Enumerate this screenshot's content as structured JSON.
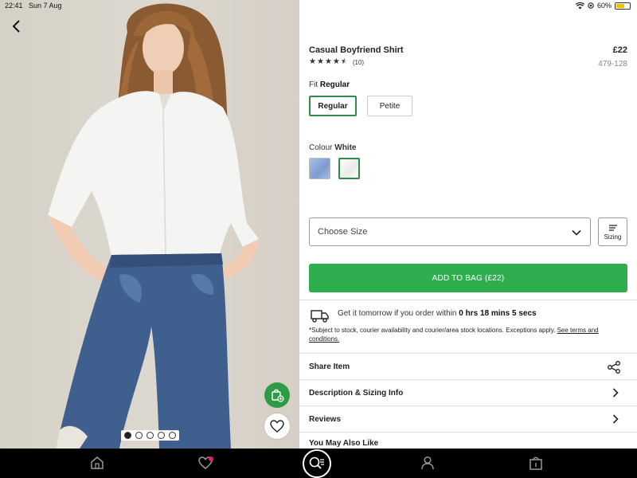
{
  "status_bar": {
    "time": "22:41",
    "date": "Sun 7 Aug",
    "battery": "60%",
    "battery_level": 0.6
  },
  "product": {
    "title": "Casual Boyfriend Shirt",
    "price": "£22",
    "code": "479-128",
    "rating": 4.5,
    "rating_count": "(10)",
    "image_count": 5,
    "active_image": 0
  },
  "fit": {
    "label": "Fit",
    "selected": "Regular",
    "options": [
      "Regular",
      "Petite"
    ]
  },
  "colour": {
    "label": "Colour",
    "selected": "White",
    "swatches": [
      "blue",
      "white"
    ]
  },
  "size_select": {
    "placeholder": "Choose Size"
  },
  "sizing_button": {
    "label": "Sizing"
  },
  "add_to_bag": {
    "label": "ADD TO BAG (£22)"
  },
  "delivery": {
    "prefix": "Get it tomorrow if you order within ",
    "countdown": "0 hrs 18 mins 5 secs",
    "disclaimer": "*Subject to stock, courier availability and courier/area stock locations. Exceptions apply. ",
    "link": "See terms and conditions."
  },
  "rows": {
    "share": "Share Item",
    "description": "Description & Sizing Info",
    "reviews": "Reviews",
    "also_like": "You May Also Like"
  },
  "icons": {
    "back": "chevron-left-icon",
    "bag_add": "bag-add-icon",
    "heart": "heart-icon",
    "share": "share-icon",
    "home": "home-icon",
    "favourites": "heart-icon",
    "search": "search-icon",
    "account": "person-icon",
    "bag": "bag-icon"
  },
  "colors": {
    "accent": "#2fae4f",
    "selected_border": "#2e8b4a",
    "tab_bar": "#000000",
    "badge": "#e6187a"
  }
}
